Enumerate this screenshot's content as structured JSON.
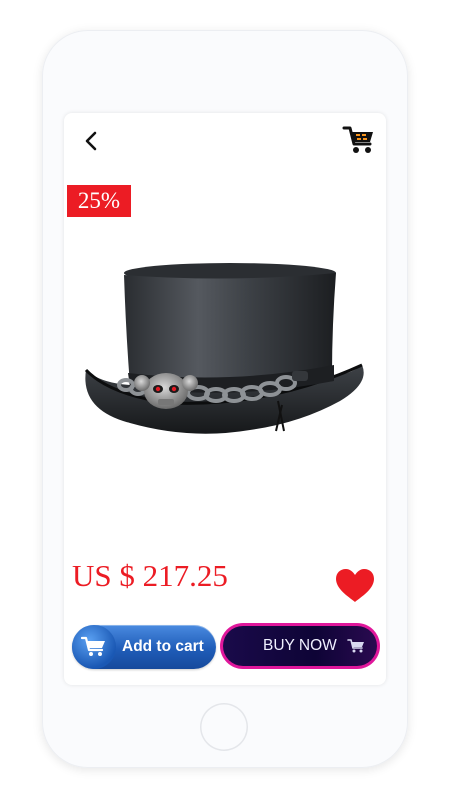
{
  "product": {
    "discount_label": "25%",
    "price": "US $ 217.25",
    "image_name": "leather-top-hat-with-skull-chain"
  },
  "actions": {
    "add_to_cart_label": "Add to cart",
    "buy_now_label": "BUY NOW"
  },
  "icons": {
    "back": "chevron-left-icon",
    "cart": "shopping-cart-icon",
    "favorite": "heart-icon"
  },
  "colors": {
    "accent_red": "#ec1c24",
    "add_cart_blue": "#1f5cb8",
    "buy_now_border": "#e0179b",
    "buy_now_fill": "#0e0436",
    "cart_icon_orange": "#f7941d"
  }
}
